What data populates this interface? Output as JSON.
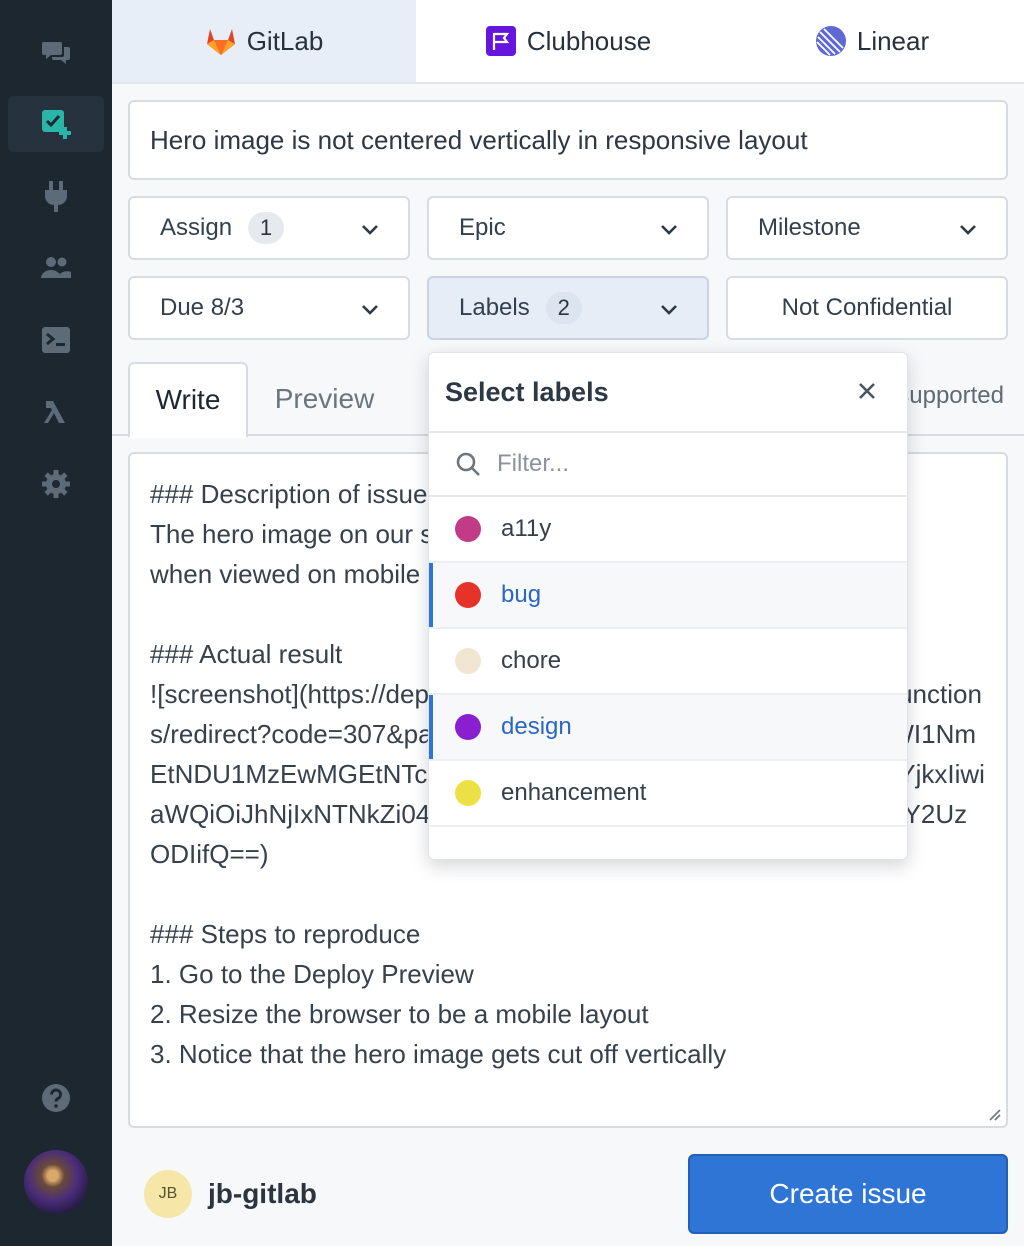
{
  "sidebar": {
    "items": [
      {
        "icon": "chat-icon"
      },
      {
        "icon": "new-issue-icon",
        "active": true
      },
      {
        "icon": "plug-icon"
      },
      {
        "icon": "users-icon"
      },
      {
        "icon": "terminal-icon"
      },
      {
        "icon": "lambda-icon"
      },
      {
        "icon": "gear-icon"
      }
    ],
    "help_icon": "help-icon",
    "avatar_icon": "avatar"
  },
  "services": {
    "tabs": [
      {
        "label": "GitLab",
        "icon": "gitlab-logo-icon",
        "active": true
      },
      {
        "label": "Clubhouse",
        "icon": "clubhouse-logo-icon"
      },
      {
        "label": "Linear",
        "icon": "linear-logo-icon"
      }
    ]
  },
  "issue": {
    "title": "Hero image is not centered vertically in responsive layout",
    "body": "### Description of issue\nThe hero image on our site does not position correctly\nwhen viewed on mobile\n\n### Actual result\n![screenshot](https://deploy-preview-3--alnafi3.netlify.app/.netlify/functions/redirect?code=307&path=eyJzaGEiOiJkNDdiYmUzNi03MGIzLWI1NmEtNDU1MzEwMGEtNTcxNTYxYTNlOGI4YWRkNzcwMDA3YzU2YjkxIiwiaWQiOiJhNjIxNTNkZi04NDQzLTQwYWMtODExNy0yZmU0OWIyY2UzODIifQ==)\n\n### Steps to reproduce\n1. Go to the Deploy Preview\n2. Resize the browser to be a mobile layout\n3. Notice that the hero image gets cut off vertically"
  },
  "fields": {
    "assign_label": "Assign",
    "assign_count": "1",
    "epic_label": "Epic",
    "milestone_label": "Milestone",
    "due_label": "Due 8/3",
    "labels_label": "Labels",
    "labels_count": "2",
    "confidential_label": "Not Confidential"
  },
  "editor_tabs": {
    "write": "Write",
    "preview": "Preview",
    "markdown_note": "Markdown supported"
  },
  "labels_popover": {
    "title": "Select labels",
    "filter_placeholder": "Filter...",
    "items": [
      {
        "name": "a11y",
        "color": "#c13b86",
        "selected": false
      },
      {
        "name": "bug",
        "color": "#e5332a",
        "selected": true
      },
      {
        "name": "chore",
        "color": "#f1e6d2",
        "selected": false
      },
      {
        "name": "design",
        "color": "#8a1fd0",
        "selected": true
      },
      {
        "name": "enhancement",
        "color": "#ece047",
        "selected": false
      }
    ]
  },
  "footer": {
    "user_initials": "JB",
    "username": "jb-gitlab",
    "create_button": "Create issue"
  },
  "colors": {
    "accent": "#2f75d6",
    "sidebar_bg": "#1d2730",
    "active_icon": "#2bb5a8"
  }
}
